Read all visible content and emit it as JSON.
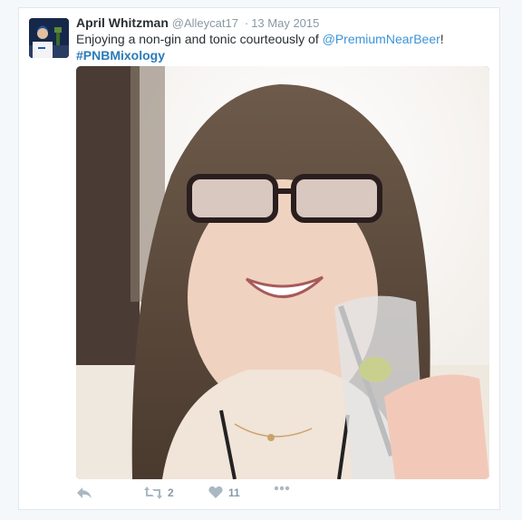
{
  "tweet": {
    "author_name": "April Whitzman",
    "author_handle": "@Alleycat17",
    "separator": "·",
    "timestamp": "13 May 2015",
    "text_before": "Enjoying a non-gin and tonic courteously of ",
    "mention": "@PremiumNearBeer",
    "text_after": "!",
    "hashtag": "#PNBMixology"
  },
  "actions": {
    "reply_icon": "reply-icon",
    "retweet_icon": "retweet-icon",
    "retweet_count": "2",
    "like_icon": "heart-icon",
    "like_count": "11",
    "more_icon": "more-icon"
  },
  "colors": {
    "link": "#3b94d9",
    "hashtag": "#2b7bb9",
    "muted": "#8899a6",
    "text": "#292f33"
  }
}
